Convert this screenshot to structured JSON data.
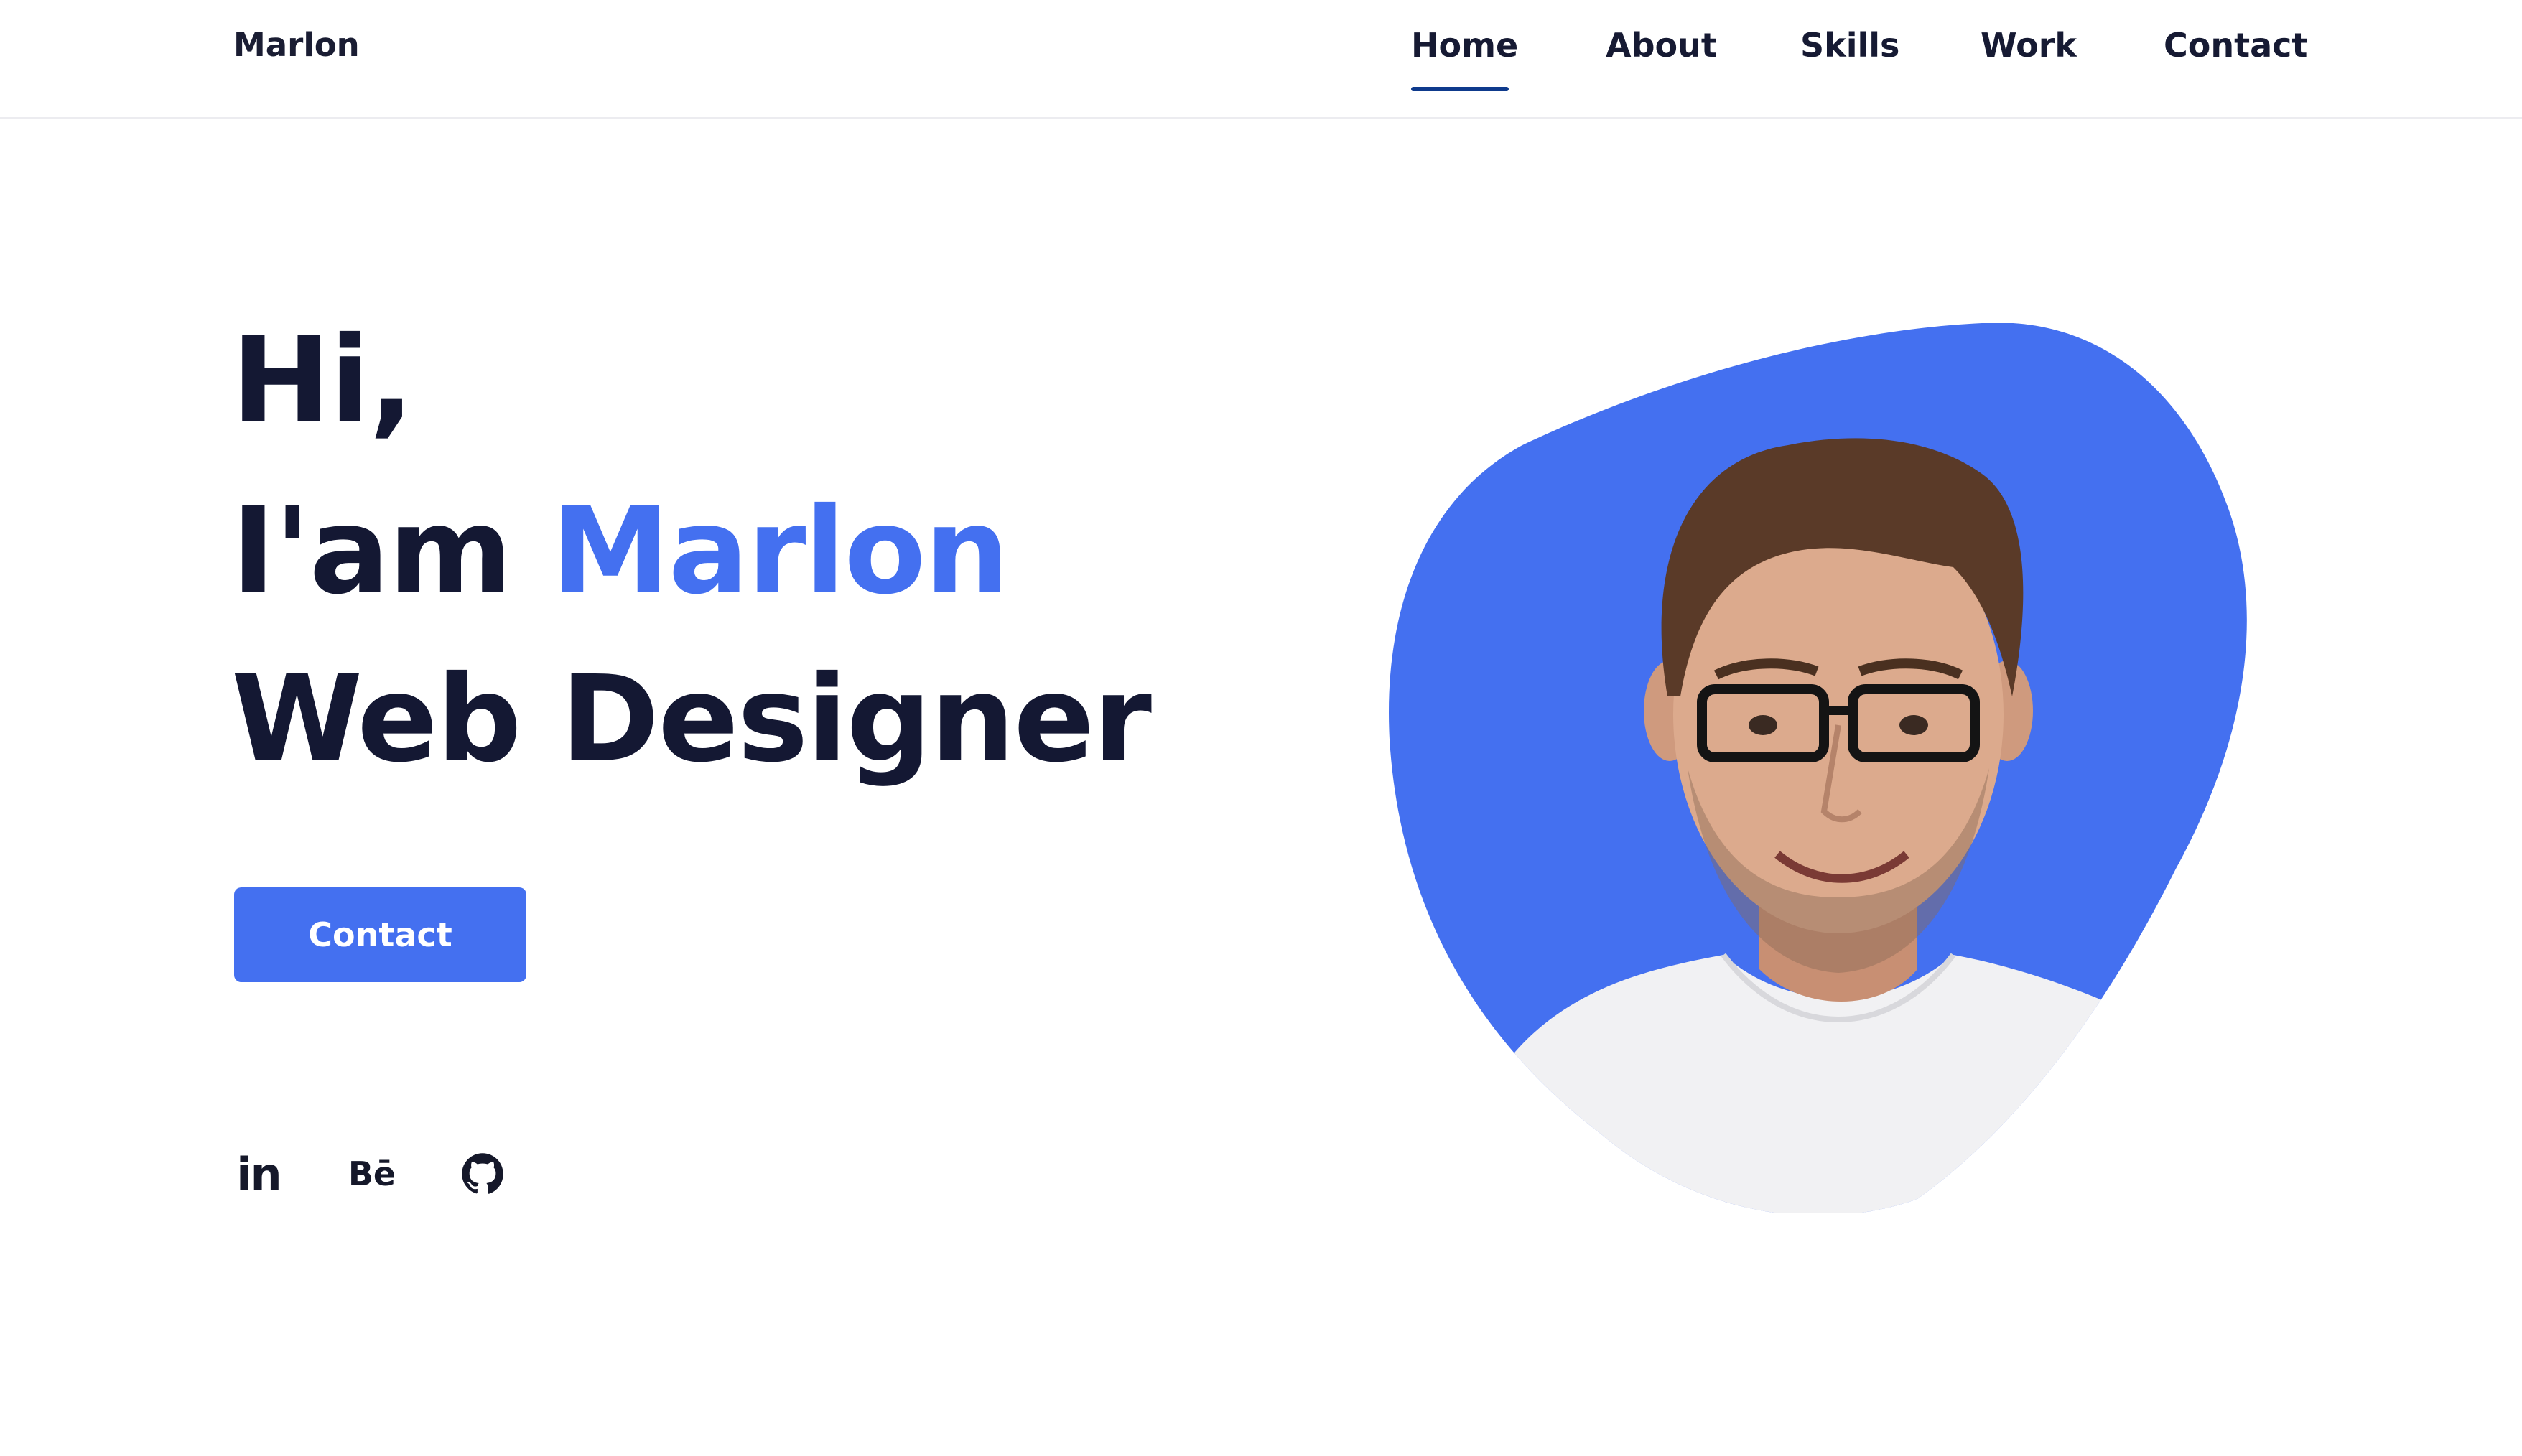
{
  "header": {
    "brand": "Marlon",
    "nav": [
      {
        "label": "Home",
        "active": true
      },
      {
        "label": "About",
        "active": false
      },
      {
        "label": "Skills",
        "active": false
      },
      {
        "label": "Work",
        "active": false
      },
      {
        "label": "Contact",
        "active": false
      }
    ]
  },
  "hero": {
    "greeting": "Hi,",
    "intro_prefix": "I'am ",
    "name": "Marlon",
    "role": "Web Designer",
    "cta_label": "Contact"
  },
  "social": [
    {
      "icon": "linkedin-icon",
      "glyph": "in"
    },
    {
      "icon": "behance-icon",
      "glyph": "Bē"
    },
    {
      "icon": "github-icon"
    }
  ],
  "colors": {
    "accent": "#4470f0",
    "text": "#141833",
    "nav_underline": "#0e3a8c",
    "background": "#ffffff"
  }
}
